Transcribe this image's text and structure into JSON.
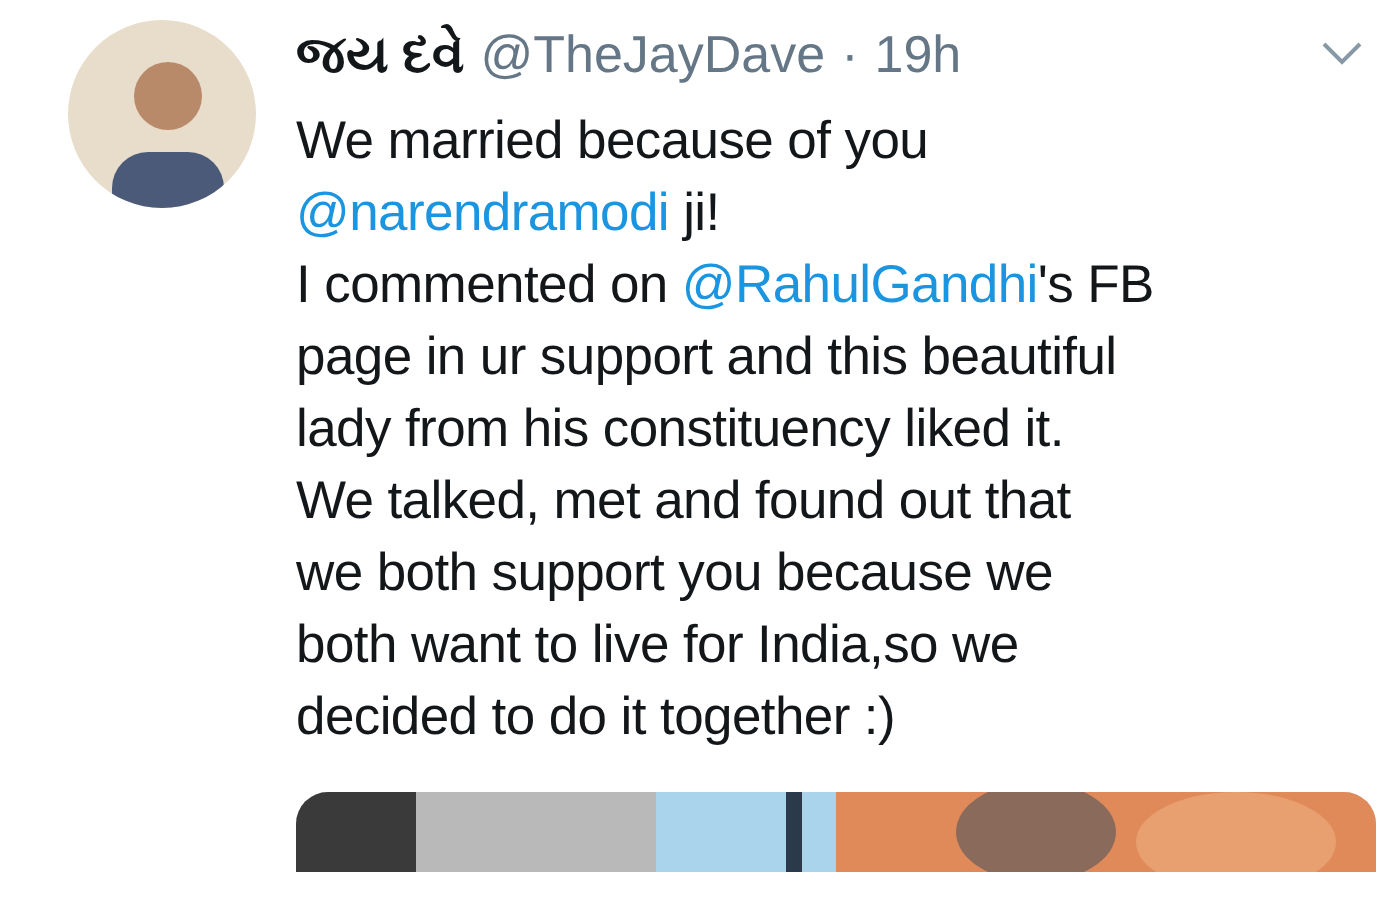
{
  "tweet": {
    "display_name": "જય દવે",
    "handle": "@TheJayDave",
    "separator": "·",
    "time": "19h",
    "lines": [
      [
        {
          "kind": "text",
          "text": "We married because of you"
        }
      ],
      [
        {
          "kind": "mention",
          "text": "@narendramodi"
        },
        {
          "kind": "text",
          "text": " ji!"
        }
      ],
      [
        {
          "kind": "text",
          "text": "I commented on "
        },
        {
          "kind": "mention",
          "text": "@RahulGandhi"
        },
        {
          "kind": "text",
          "text": "'s FB"
        }
      ],
      [
        {
          "kind": "text",
          "text": "page in ur support and this beautiful"
        }
      ],
      [
        {
          "kind": "text",
          "text": "lady from his constituency liked it."
        }
      ],
      [
        {
          "kind": "text",
          "text": "We talked, met and found out that"
        }
      ],
      [
        {
          "kind": "text",
          "text": "we both support you because we"
        }
      ],
      [
        {
          "kind": "text",
          "text": "both want to live for India,so we"
        }
      ],
      [
        {
          "kind": "text",
          "text": "decided to do it together :)"
        }
      ]
    ],
    "media": {
      "kind": "picture"
    }
  }
}
